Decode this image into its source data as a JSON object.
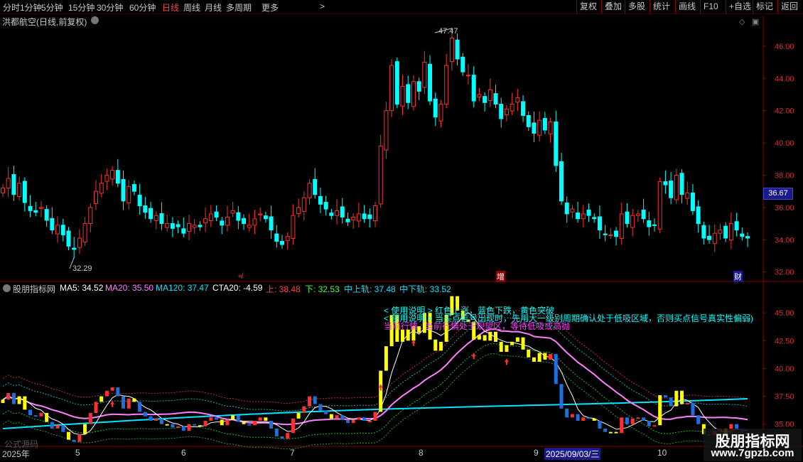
{
  "toolbar": {
    "periods": [
      "分时",
      "1分钟",
      "5分钟",
      "15分钟",
      "30分钟",
      "60分钟",
      "日线",
      "周线",
      "月线",
      "多周期",
      "更多"
    ],
    "active": "日线",
    "more_arrow": ">",
    "right": [
      "复权",
      "叠加",
      "多股",
      "统计",
      "画线",
      "F10",
      "+自选",
      "标记",
      "返回"
    ]
  },
  "main": {
    "title": "洪都航空(日线,前复权)",
    "y_labels": [
      "46.00",
      "44.00",
      "42.00",
      "40.00",
      "38.00",
      "36.00",
      "34.00",
      "32.00"
    ],
    "price_badge": "36.67",
    "high_label": "47.47",
    "low_label": "32.29",
    "markers": {
      "m1": "≉",
      "m2": "增",
      "m3": "财"
    }
  },
  "indicator": {
    "name": "股朋指标网",
    "ma5": "MA5: 34.52",
    "ma20": "MA20: 35.50",
    "ma120": "MA120: 37.47",
    "cta20": "CTA20: -4.59",
    "up": "上: 38.48",
    "down": "下: 32.53",
    "mid_up": "中上轨: 37.48",
    "mid_down": "中下轨: 33.52",
    "y_labels": [
      "45.00",
      "42.50",
      "40.00",
      "37.50",
      "35.00"
    ],
    "note1": "< 使用说明 > 红色上涨，蓝色下跌，黄色突破",
    "note2": "< 使用说明 > 当买点信号出现时，先用大一级别周期确认处于低吸区域，否则买点信号真实性偏弱)",
    "note3": "当前行情 : 当前行情处于观望区，等待低吸或高抛"
  },
  "axis": {
    "labels": [
      "2025年",
      "5",
      "6",
      "7",
      "8",
      "9",
      "10"
    ],
    "date_badge": "2025/09/03/三"
  },
  "formula": "公式源码",
  "watermark": {
    "title": "股朋指标网",
    "url": "www.7gpzb.com"
  },
  "colors": {
    "up": "#ff3030",
    "down": "#00ffff",
    "ma20": "#ff80ff",
    "ma120": "#00e5ff",
    "breakout": "#ffff00",
    "bg": "#000000"
  },
  "chart_data": {
    "type": "candlestick",
    "title": "洪都航空(日线,前复权)",
    "ylim": [
      31.5,
      47.8
    ],
    "y_ticks": [
      32,
      34,
      36,
      38,
      40,
      42,
      44,
      46
    ],
    "closes": [
      37.2,
      37.8,
      36.8,
      37.5,
      36.3,
      35.8,
      35.7,
      36.0,
      35.2,
      34.6,
      34.9,
      34.3,
      33.6,
      33.4,
      34.1,
      35.0,
      36.0,
      37.0,
      37.5,
      38.0,
      38.3,
      37.5,
      36.4,
      37.3,
      37.0,
      36.1,
      35.7,
      35.3,
      35.5,
      35.0,
      35.0,
      34.7,
      34.8,
      34.4,
      35.0,
      34.9,
      34.8,
      35.3,
      35.6,
      35.4,
      34.9,
      35.4,
      35.8,
      35.2,
      35.0,
      34.9,
      35.3,
      35.6,
      35.3,
      34.6,
      33.9,
      33.7,
      34.2,
      35.5,
      36.0,
      36.6,
      37.5,
      36.8,
      36.2,
      35.9,
      35.5,
      35.8,
      35.4,
      35.1,
      35.4,
      35.6,
      35.3,
      35.3,
      36.1,
      39.8,
      42.0,
      44.8,
      42.4,
      43.5,
      42.5,
      43.8,
      43.2,
      45.0,
      42.6,
      41.6,
      42.4,
      44.8,
      46.5,
      45.2,
      44.4,
      44.2,
      42.6,
      43.0,
      42.5,
      43.3,
      42.4,
      41.5,
      42.1,
      42.4,
      42.8,
      41.7,
      41.0,
      40.6,
      41.4,
      40.8,
      41.3,
      38.6,
      36.4,
      35.6,
      35.9,
      35.3,
      35.6,
      35.5,
      35.3,
      34.6,
      34.3,
      34.3,
      34.2,
      35.6,
      35.0,
      35.5,
      35.6,
      35.3,
      34.8,
      34.9,
      37.6,
      37.4,
      36.6,
      38.0,
      36.8,
      36.9,
      35.8,
      35.0,
      34.1,
      34.0,
      34.4,
      34.6,
      34.1,
      35.0,
      34.6,
      34.2,
      34.1
    ]
  }
}
